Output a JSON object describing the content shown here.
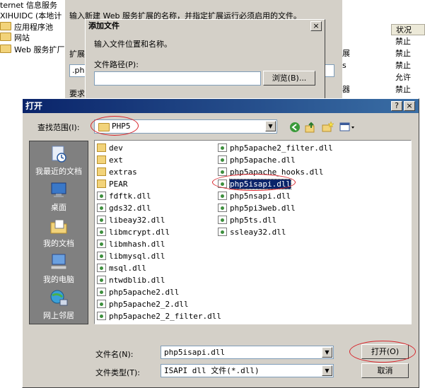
{
  "background": {
    "tree": {
      "root_label": "ternet 信息服务",
      "computer_label": "XIHUIDC (本地计",
      "items": [
        "应用程序池",
        "网站",
        "Web 服务扩厂"
      ]
    },
    "wizard": {
      "instruction": "输入新建 Web 服务扩展的名称，并指定扩展运行必须启用的文件。",
      "label_ext": "扩展",
      "label_req": "要求",
      "field_value": ".ph"
    },
    "right_panel": {
      "column_header": "状况",
      "statuses": [
        "禁止",
        "禁止",
        "禁止",
        "允许",
        "禁止"
      ],
      "partial_texts": [
        "展",
        "s",
        "器"
      ]
    }
  },
  "add_file_dialog": {
    "title": "添加文件",
    "close_label": "×",
    "instruction": "输入文件位置和名称。",
    "path_label": "文件路径(P):",
    "path_value": "",
    "browse_label": "浏览(B)..."
  },
  "open_dialog": {
    "title": "打开",
    "help_label": "?",
    "close_label": "×",
    "lookin_label": "查找范围(I):",
    "lookin_value": "PHP5",
    "places": [
      "我最近的文档",
      "桌面",
      "我的文档",
      "我的电脑",
      "网上邻居"
    ],
    "files_col1": [
      {
        "name": "dev",
        "type": "folder"
      },
      {
        "name": "ext",
        "type": "folder"
      },
      {
        "name": "extras",
        "type": "folder"
      },
      {
        "name": "PEAR",
        "type": "folder"
      },
      {
        "name": "fdftk.dll",
        "type": "dll"
      },
      {
        "name": "gds32.dll",
        "type": "dll"
      },
      {
        "name": "libeay32.dll",
        "type": "dll"
      },
      {
        "name": "libmcrypt.dll",
        "type": "dll"
      },
      {
        "name": "libmhash.dll",
        "type": "dll"
      },
      {
        "name": "libmysql.dll",
        "type": "dll"
      },
      {
        "name": "msql.dll",
        "type": "dll"
      },
      {
        "name": "ntwdblib.dll",
        "type": "dll"
      },
      {
        "name": "php5apache2.dll",
        "type": "dll"
      },
      {
        "name": "php5apache2_2.dll",
        "type": "dll"
      },
      {
        "name": "php5apache2_2_filter.dll",
        "type": "dll"
      }
    ],
    "files_col2": [
      {
        "name": "php5apache2_filter.dll",
        "type": "dll"
      },
      {
        "name": "php5apache.dll",
        "type": "dll"
      },
      {
        "name": "php5apache_hooks.dll",
        "type": "dll"
      },
      {
        "name": "php5isapi.dll",
        "type": "dll",
        "selected": true
      },
      {
        "name": "php5nsapi.dll",
        "type": "dll"
      },
      {
        "name": "php5pi3web.dll",
        "type": "dll"
      },
      {
        "name": "php5ts.dll",
        "type": "dll"
      },
      {
        "name": "ssleay32.dll",
        "type": "dll"
      }
    ],
    "filename_label": "文件名(N):",
    "filename_value": "php5isapi.dll",
    "filetype_label": "文件类型(T):",
    "filetype_value": "ISAPI dll 文件(*.dll)",
    "open_button": "打开(O)",
    "cancel_button": "取消"
  },
  "colors": {
    "titlebar_start": "#0a246a",
    "titlebar_end": "#3a6ea5",
    "dialog_face": "#d4d0c8",
    "highlight_ellipse": "#d8232a",
    "selection": "#0a246a"
  }
}
